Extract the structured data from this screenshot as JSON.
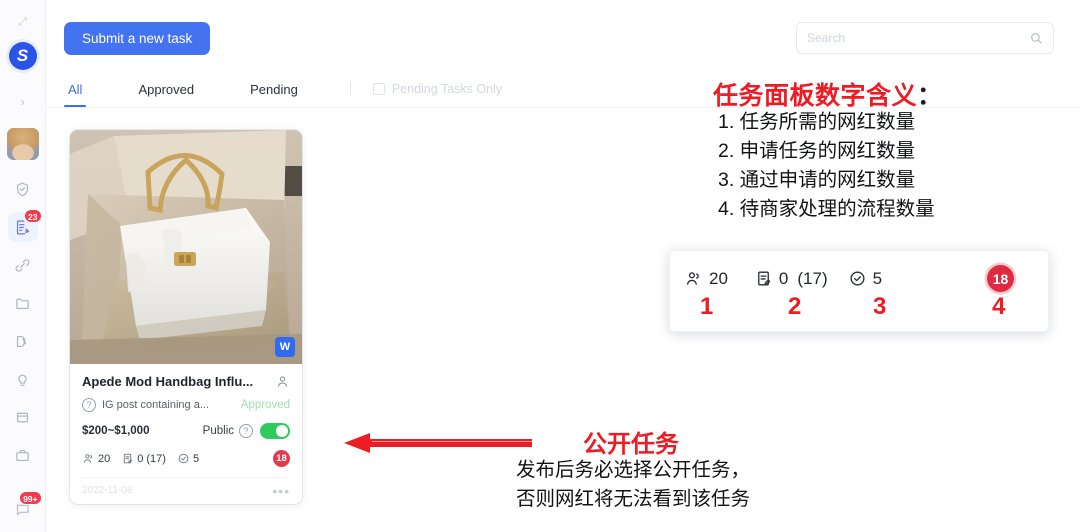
{
  "colors": {
    "brand_blue": "#3c6ef0",
    "annotation_red": "#ed1c24",
    "badge_red": "#e23b4f",
    "toggle_green": "#2ecb5c",
    "approved_green": "#9ee0b4"
  },
  "rail": {
    "logo_letter": "S",
    "expand_glyph": "›",
    "top_glyph": "⤢",
    "items": [
      {
        "name": "shield-check-icon",
        "badge": ""
      },
      {
        "name": "document-edit-icon",
        "badge": "23",
        "active": true
      },
      {
        "name": "link-icon",
        "badge": ""
      },
      {
        "name": "folder-icon",
        "badge": ""
      },
      {
        "name": "palette-icon",
        "badge": ""
      },
      {
        "name": "lightbulb-icon",
        "badge": ""
      },
      {
        "name": "box-icon",
        "badge": ""
      },
      {
        "name": "briefcase-icon",
        "badge": ""
      }
    ],
    "bottom_item": {
      "name": "chat-icon",
      "badge": "99+"
    }
  },
  "toolbar": {
    "submit_label": "Submit a new task"
  },
  "search": {
    "placeholder": "Search",
    "value": "",
    "icon": "search-icon"
  },
  "tabs": {
    "items": [
      {
        "label": "All",
        "active": true
      },
      {
        "label": "Approved",
        "active": false
      },
      {
        "label": "Pending",
        "active": false
      }
    ],
    "checkbox_label": "Pending Tasks Only",
    "checkbox_checked": false
  },
  "card": {
    "image_badge": "W",
    "title": "Apede Mod Handbag Influ...",
    "owner_icon": "person-icon",
    "help_icon": "question-icon",
    "description": "IG post containing a...",
    "status": "Approved",
    "price": "$200~$1,000",
    "visibility_label": "Public",
    "visibility_help_icon": "question-icon",
    "visibility_on": true,
    "stats": {
      "influencers_required": "20",
      "applied": "0",
      "applied_paren": "(17)",
      "approved": "5",
      "pending_actions": "18"
    },
    "date": "2022-11-08",
    "more_icon": "ellipsis-icon"
  },
  "annotations": {
    "heading_text": "任务面板数字含义",
    "heading_colon": "：",
    "list": [
      "1. 任务所需的网红数量",
      "2. 申请任务的网红数量",
      "3. 通过申请的网红数量",
      "4. 待商家处理的流程数量"
    ],
    "marks": [
      "1",
      "2",
      "3",
      "4"
    ],
    "public_title": "公开任务",
    "public_lines": [
      "发布后务必选择公开任务，",
      "否则网红将无法看到该任务"
    ]
  },
  "panel": {
    "influencers_required": "20",
    "applied": "0",
    "applied_paren": "(17)",
    "approved": "5",
    "pending_actions": "18"
  }
}
